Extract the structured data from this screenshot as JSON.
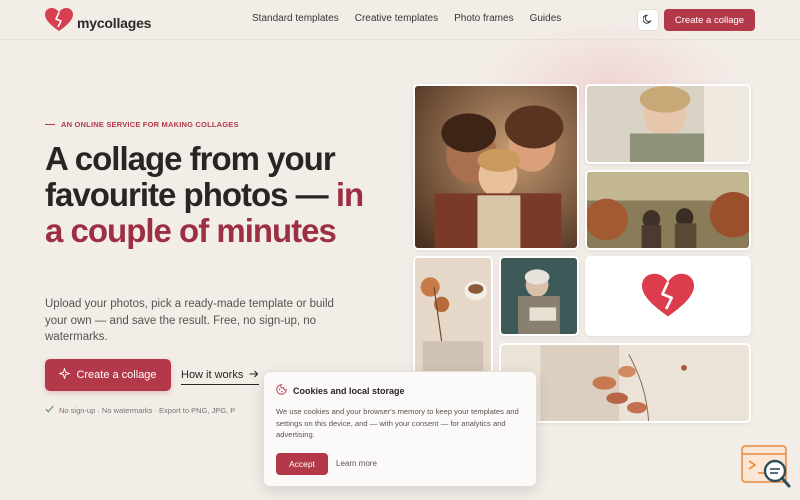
{
  "header": {
    "brand": "mycollages",
    "nav": [
      "Standard templates",
      "Creative templates",
      "Photo frames",
      "Guides"
    ],
    "cta_label": "Create a collage"
  },
  "hero": {
    "eyebrow": "AN ONLINE SERVICE FOR MAKING COLLAGES",
    "headline_part1": "A collage from your favourite photos — ",
    "headline_accent": "in a couple of minutes",
    "subtext": "Upload your photos, pick a ready-made template or build your own — and save the result. Free, no sign-up, no watermarks.",
    "primary_cta": "Create a collage",
    "secondary_cta": "How it works",
    "features": "No sign-up · No watermarks · Export to PNG, JPG, P"
  },
  "cookie": {
    "title": "Cookies and local storage",
    "body": "We use cookies and your browser's memory to keep your templates and settings on this device, and — with your consent — for analytics and advertising.",
    "accept_label": "Accept",
    "learn_more_label": "Learn more"
  },
  "icons": {
    "logo": "heart-logo-icon",
    "theme": "moon-icon",
    "sparkle": "sparkle-icon",
    "arrow": "arrow-right-icon",
    "check": "check-icon",
    "cookie": "cookie-icon"
  },
  "colors": {
    "accent": "#b3394a",
    "accent_dark": "#9c2f44",
    "background": "#f3ede8",
    "text": "#2a2424"
  }
}
